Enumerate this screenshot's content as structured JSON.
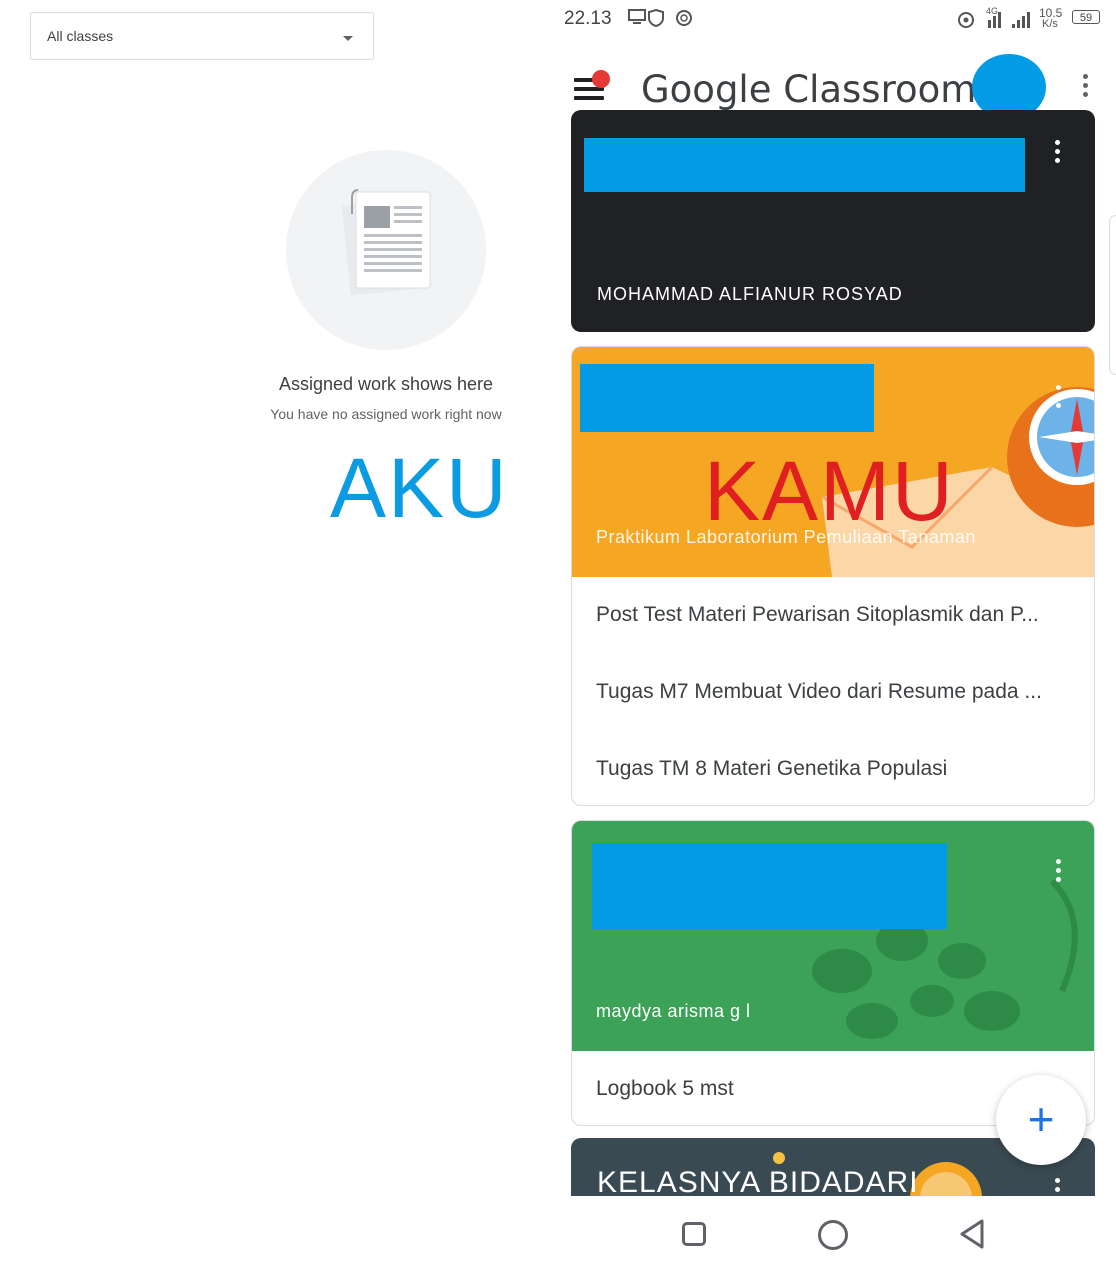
{
  "left_panel": {
    "class_filter": {
      "selected": "All classes"
    },
    "empty_state": {
      "title": "Assigned work shows here",
      "subtitle": "You have no assigned work right now"
    },
    "annotation": "AKU"
  },
  "phone": {
    "status_bar": {
      "time": "22.13",
      "network_speed": "10.5",
      "network_speed_unit": "K/s",
      "network_type": "4G",
      "battery": "59"
    },
    "app_bar": {
      "title": "Google Classroom"
    },
    "annotation": "KAMU",
    "cards": [
      {
        "owner": "MOHAMMAD ALFIANUR ROSYAD",
        "banner_color": "#202124"
      },
      {
        "section": "Praktikum Laboratorium Pemuliaan Tanaman",
        "banner_color": "#f5a623",
        "tasks": [
          "Post Test Materi Pewarisan Sitoplasmik dan P...",
          "Tugas M7 Membuat Video dari Resume pada ...",
          "Tugas TM 8 Materi Genetika Populasi"
        ]
      },
      {
        "owner": "maydya arisma g l",
        "banner_color": "#3ca257",
        "tasks": [
          "Logbook 5 mst"
        ]
      },
      {
        "title": "KELASNYA BIDADARI",
        "banner_color": "#3a4a52"
      }
    ],
    "fab_label": "+",
    "redaction_color": "#039be5"
  }
}
